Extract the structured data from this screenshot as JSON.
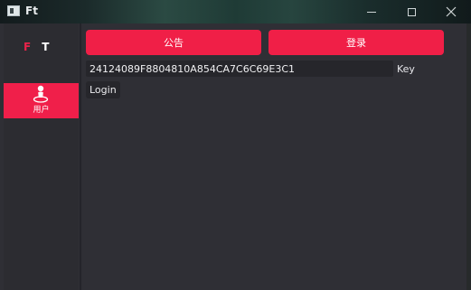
{
  "window": {
    "title": "Ft"
  },
  "sidebar": {
    "logo_f": "F",
    "logo_t": "T",
    "items": [
      {
        "label": "用户",
        "icon": "user-pin-icon",
        "active": true
      }
    ]
  },
  "main": {
    "notice_button": "公告",
    "login_button": "登录",
    "key_value": "24124089F8804810A854CA7C6C69E3C1",
    "key_label": "Key",
    "login_small_button": "Login"
  },
  "colors": {
    "accent": "#f01f47",
    "background": "#2f2f35",
    "sidebar": "#2c2c31",
    "input_bg": "#26262b"
  }
}
